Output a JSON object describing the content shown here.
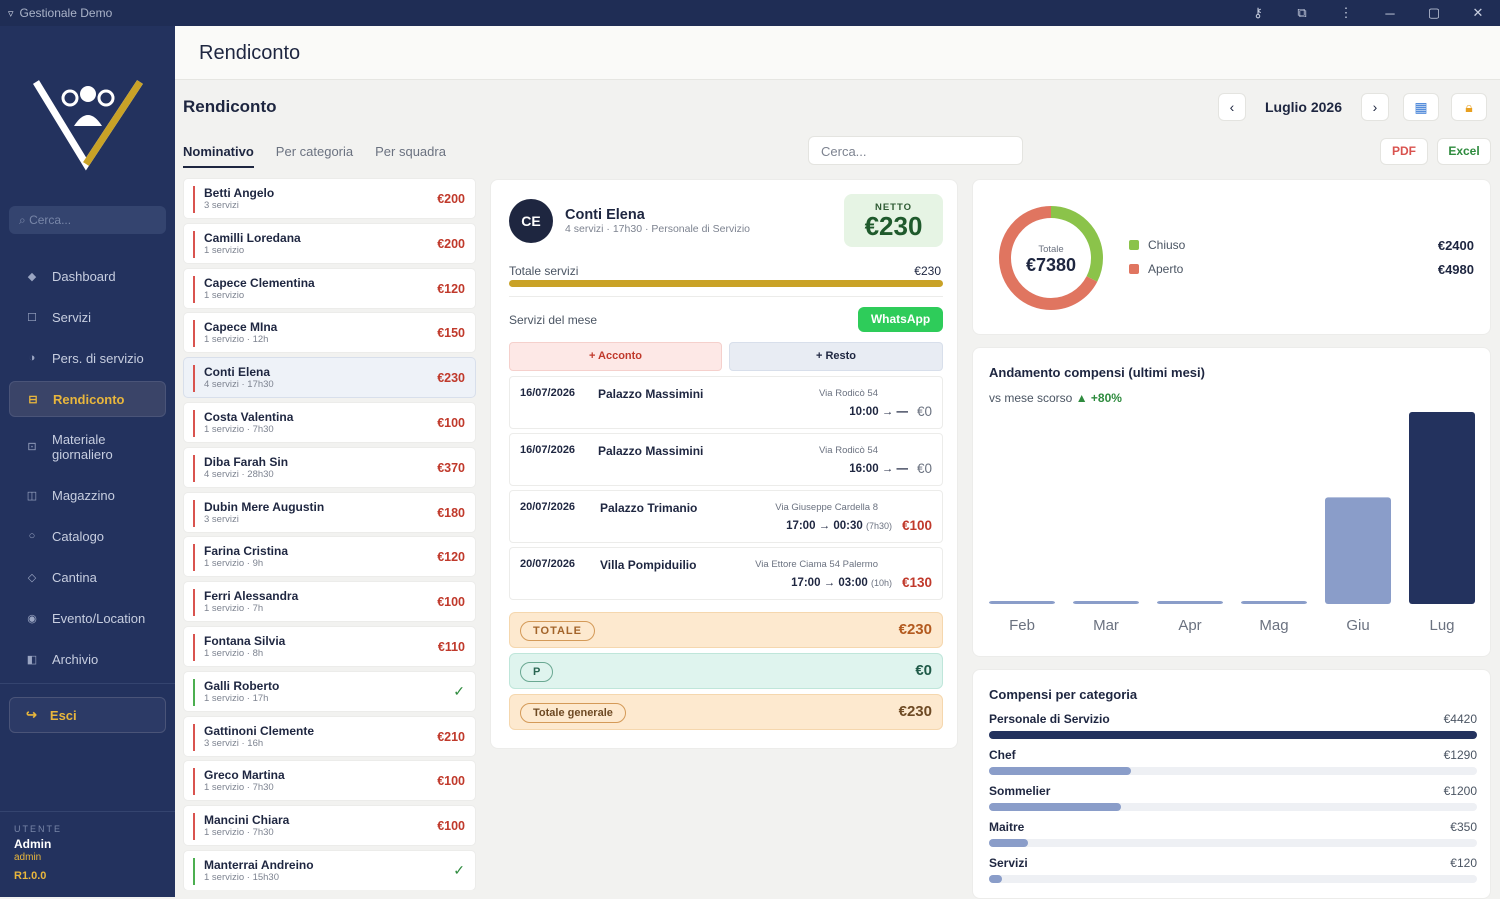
{
  "window": {
    "title": "Gestionale Demo"
  },
  "sidebar": {
    "search_placeholder": "Cerca...",
    "items": [
      {
        "label": "Dashboard",
        "icon": "diamond-icon"
      },
      {
        "label": "Servizi",
        "icon": "square-icon"
      },
      {
        "label": "Pers. di servizio",
        "icon": "half-circle-icon"
      },
      {
        "label": "Rendiconto",
        "icon": "ledger-icon",
        "active": true
      },
      {
        "label": "Materiale giornaliero",
        "icon": "box-icon"
      },
      {
        "label": "Magazzino",
        "icon": "columns-icon"
      },
      {
        "label": "Catalogo",
        "icon": "circle-icon"
      },
      {
        "label": "Cantina",
        "icon": "diamond-outline-icon"
      },
      {
        "label": "Evento/Location",
        "icon": "dot-icon"
      },
      {
        "label": "Archivio",
        "icon": "archive-icon"
      }
    ],
    "logout_label": "Esci",
    "user_label": "UTENTE",
    "user_name": "Admin",
    "user_role": "admin",
    "version": "R1.0.0"
  },
  "header": {
    "title": "Rendiconto"
  },
  "section": {
    "title": "Rendiconto",
    "month": "Luglio 2026",
    "tabs": [
      "Nominativo",
      "Per categoria",
      "Per squadra"
    ],
    "search_placeholder": "Cerca...",
    "pdf_label": "PDF",
    "excel_label": "Excel"
  },
  "people": [
    {
      "name": "Betti Angelo",
      "sub": "3 servizi",
      "amount": "€200"
    },
    {
      "name": "Camilli Loredana",
      "sub": "1 servizio",
      "amount": "€200"
    },
    {
      "name": "Capece Clementina",
      "sub": "1 servizio",
      "amount": "€120"
    },
    {
      "name": "Capece MIna",
      "sub": "1 servizio · 12h",
      "amount": "€150"
    },
    {
      "name": "Conti Elena",
      "sub": "4 servizi · 17h30",
      "amount": "€230",
      "selected": true
    },
    {
      "name": "Costa Valentina",
      "sub": "1 servizio · 7h30",
      "amount": "€100"
    },
    {
      "name": "Diba Farah Sin",
      "sub": "4 servizi · 28h30",
      "amount": "€370"
    },
    {
      "name": "Dubin Mere Augustin",
      "sub": "3 servizi",
      "amount": "€180"
    },
    {
      "name": "Farina Cristina",
      "sub": "1 servizio · 9h",
      "amount": "€120"
    },
    {
      "name": "Ferri Alessandra",
      "sub": "1 servizio · 7h",
      "amount": "€100"
    },
    {
      "name": "Fontana Silvia",
      "sub": "1 servizio · 8h",
      "amount": "€110"
    },
    {
      "name": "Galli Roberto",
      "sub": "1 servizio · 17h",
      "amount": "✓",
      "paid": true
    },
    {
      "name": "Gattinoni Clemente",
      "sub": "3 servizi · 16h",
      "amount": "€210"
    },
    {
      "name": "Greco Martina",
      "sub": "1 servizio · 7h30",
      "amount": "€100"
    },
    {
      "name": "Mancini Chiara",
      "sub": "1 servizio · 7h30",
      "amount": "€100"
    },
    {
      "name": "Manterrai Andreino",
      "sub": "1 servizio · 15h30",
      "amount": "✓",
      "paid": true
    }
  ],
  "detail": {
    "initials": "CE",
    "name": "Conti Elena",
    "sub": "4 servizi · 17h30 · Personale di Servizio",
    "netto_label": "NETTO",
    "netto_value": "€230",
    "total_services_label": "Totale servizi",
    "total_services_value": "€230",
    "month_services_label": "Servizi del mese",
    "whatsapp_label": "WhatsApp",
    "acconto_label": "+ Acconto",
    "resto_label": "+ Resto",
    "services": [
      {
        "date": "16/07/2026",
        "place": "Palazzo Massimini",
        "address": "Via Rodicò 54",
        "time": "10:00 → —",
        "dur": "",
        "price": "€0"
      },
      {
        "date": "16/07/2026",
        "place": "Palazzo Massimini",
        "address": "Via Rodicò 54",
        "time": "16:00 → —",
        "dur": "",
        "price": "€0"
      },
      {
        "date": "20/07/2026",
        "place": "Palazzo Trimanio",
        "address": "Via Giuseppe Cardella 8",
        "time": "17:00 → 00:30",
        "dur": "(7h30)",
        "price": "€100"
      },
      {
        "date": "20/07/2026",
        "place": "Villa Pompiduilio",
        "address": "Via Ettore Ciama 54 Palermo",
        "time": "17:00 → 03:00",
        "dur": "(10h)",
        "price": "€130"
      }
    ],
    "totale_label": "TOTALE",
    "totale_value": "€230",
    "p_label": "P",
    "p_value": "€0",
    "generale_label": "Totale generale",
    "generale_value": "€230"
  },
  "summary": {
    "total_label": "Totale",
    "total_value": "€7380",
    "legend": [
      {
        "label": "Chiuso",
        "value": "€2400",
        "color": "#8bc34a",
        "amount": 2400
      },
      {
        "label": "Aperto",
        "value": "€4980",
        "color": "#e07560",
        "amount": 4980
      }
    ]
  },
  "chart_data": {
    "type": "bar",
    "title": "Andamento compensi (ultimi mesi)",
    "subtitle_prefix": "vs mese scorso",
    "subtitle_change": "▲ +80%",
    "categories": [
      "Feb",
      "Mar",
      "Apr",
      "Mag",
      "Giu",
      "Lug"
    ],
    "values": [
      0,
      0,
      0,
      0,
      4100,
      7380
    ],
    "colors": [
      "#8a9dc9",
      "#8a9dc9",
      "#8a9dc9",
      "#8a9dc9",
      "#8a9dc9",
      "#23325e"
    ],
    "ylim": [
      0,
      7380
    ],
    "grid": false
  },
  "categories_card": {
    "title": "Compensi per categoria",
    "max": 4420,
    "rows": [
      {
        "name": "Personale di Servizio",
        "value": "€4420",
        "amount": 4420,
        "color": "#23325e"
      },
      {
        "name": "Chef",
        "value": "€1290",
        "amount": 1290,
        "color": "#8a9dc9"
      },
      {
        "name": "Sommelier",
        "value": "€1200",
        "amount": 1200,
        "color": "#8a9dc9"
      },
      {
        "name": "Maitre",
        "value": "€350",
        "amount": 350,
        "color": "#8a9dc9"
      },
      {
        "name": "Servizi",
        "value": "€120",
        "amount": 120,
        "color": "#8a9dc9"
      }
    ]
  }
}
